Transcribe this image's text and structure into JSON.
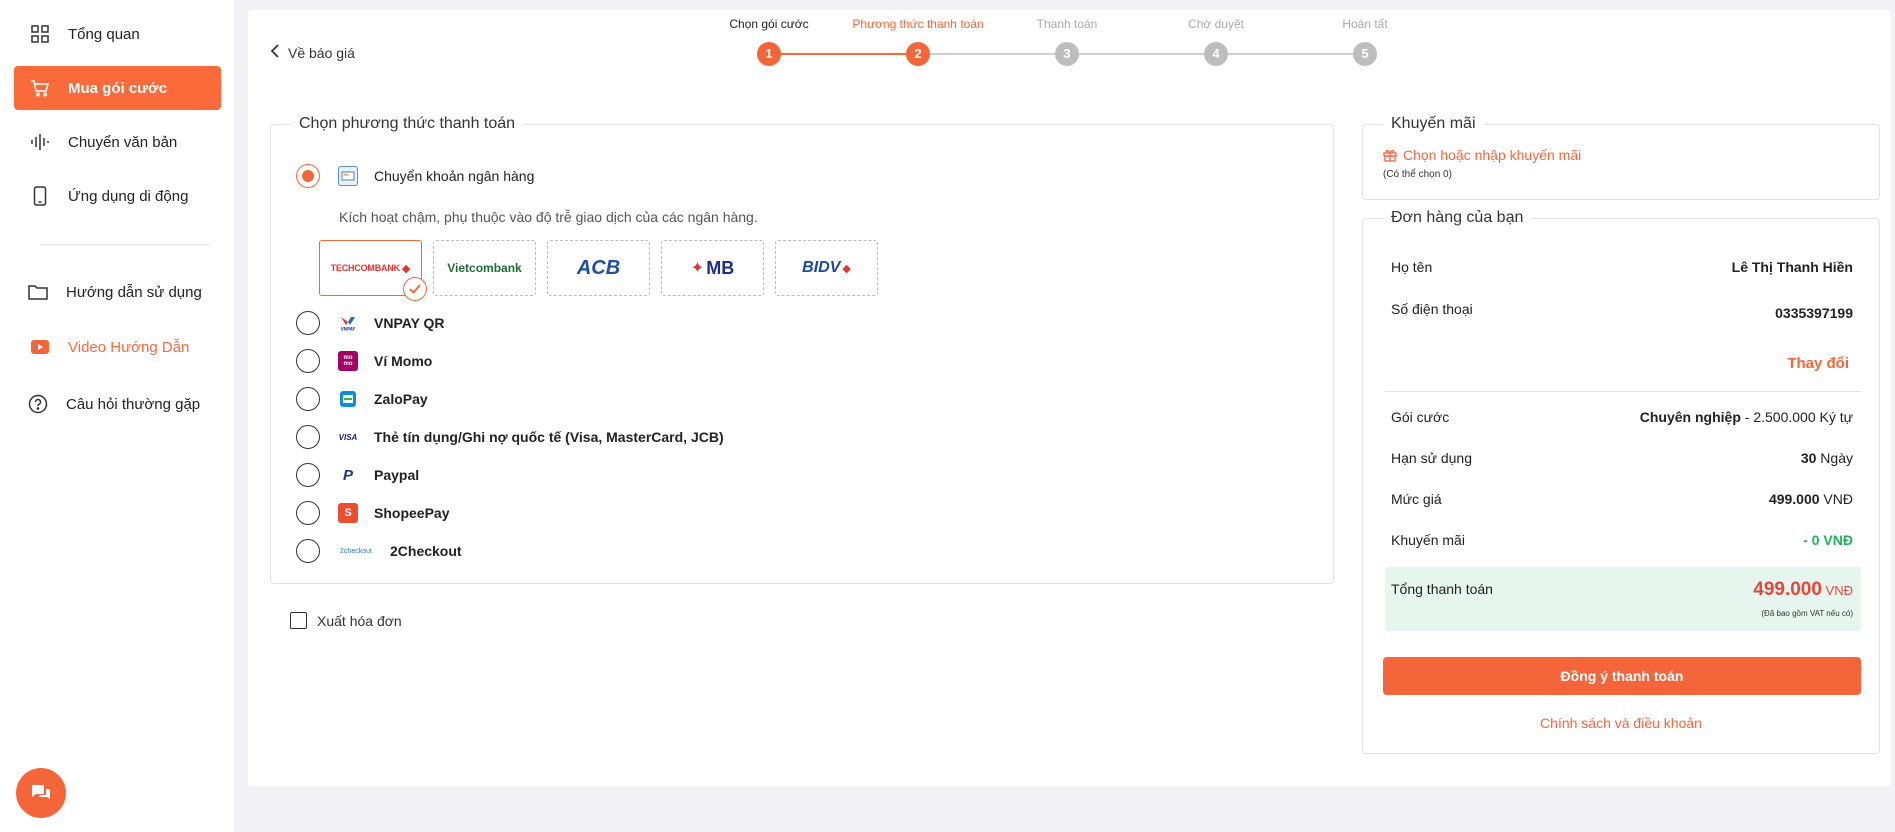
{
  "sidebar": {
    "items": [
      {
        "label": "Tổng quan",
        "icon": "grid-icon"
      },
      {
        "label": "Mua gói cước",
        "icon": "cart-icon"
      },
      {
        "label": "Chuyển văn bản",
        "icon": "audio-wave-icon"
      },
      {
        "label": "Ứng dụng di động",
        "icon": "phone-icon"
      },
      {
        "label": "Hướng dẫn sử dụng",
        "icon": "folder-icon"
      },
      {
        "label": "Video Hướng Dẫn",
        "icon": "video-play-icon"
      },
      {
        "label": "Câu hỏi thường gặp",
        "icon": "help-circle-icon"
      }
    ]
  },
  "back_label": "Về báo giá",
  "stepper": {
    "steps": [
      {
        "label": "Chọn gói cước",
        "number": "1",
        "state": "done"
      },
      {
        "label": "Phương thức thanh toán",
        "number": "2",
        "state": "current"
      },
      {
        "label": "Thanh toán",
        "number": "3",
        "state": "pending"
      },
      {
        "label": "Chờ duyệt",
        "number": "4",
        "state": "pending"
      },
      {
        "label": "Hoàn tất",
        "number": "5",
        "state": "pending"
      }
    ]
  },
  "payment": {
    "legend": "Chọn phương thức thanh toán",
    "bank_transfer": {
      "label": "Chuyển khoản ngân hàng",
      "description": "Kích hoạt chậm, phụ thuộc vào độ trễ giao dịch của các ngân hàng.",
      "banks": [
        "TECHCOMBANK",
        "Vietcombank",
        "ACB",
        "MB",
        "BIDV"
      ],
      "selected_bank": "TECHCOMBANK"
    },
    "methods": [
      {
        "label": "VNPAY QR",
        "logo_text": "VNPAY"
      },
      {
        "label": "Ví Momo",
        "logo_text": "mo mo"
      },
      {
        "label": "ZaloPay",
        "logo_text": "Zalo"
      },
      {
        "label": "Thẻ tín dụng/Ghi nợ quốc tế (Visa, MasterCard, JCB)",
        "logo_text": "VISA"
      },
      {
        "label": "Paypal",
        "logo_text": "P"
      },
      {
        "label": "ShopeePay",
        "logo_text": "S"
      },
      {
        "label": "2Checkout",
        "logo_text": "2checkout"
      }
    ],
    "invoice_label": "Xuất hóa đơn"
  },
  "promo": {
    "legend": "Khuyến mãi",
    "link": "Chọn hoặc nhập khuyến mãi",
    "note": "(Có thể chọn 0)"
  },
  "order": {
    "legend": "Đơn hàng của bạn",
    "name_label": "Họ tên",
    "name_value": "Lê Thị Thanh Hiền",
    "phone_label": "Số điện thoại",
    "phone_value": "0335397199",
    "change_label": "Thay đổi",
    "package_label": "Gói cước",
    "package_name": "Chuyên nghiệp",
    "package_detail": " - 2.500.000 Ký tự",
    "duration_label": "Hạn sử dụng",
    "duration_value": "30",
    "duration_unit": " Ngày",
    "price_label": "Mức giá",
    "price_value": "499.000",
    "price_unit": " VNĐ",
    "discount_label": "Khuyến mãi",
    "discount_value": "- 0 VNĐ",
    "total_label": "Tổng thanh toán",
    "total_value": "499.000",
    "total_unit": " VNĐ",
    "total_note": "(Đã bao gồm VAT nếu có)",
    "agree_label": "Đồng ý thanh toán",
    "policy_label": "Chính sách và điều khoản"
  },
  "colors": {
    "accent": "#f4663a",
    "discount": "#21b35a",
    "total_bg": "#e6f6ee"
  }
}
